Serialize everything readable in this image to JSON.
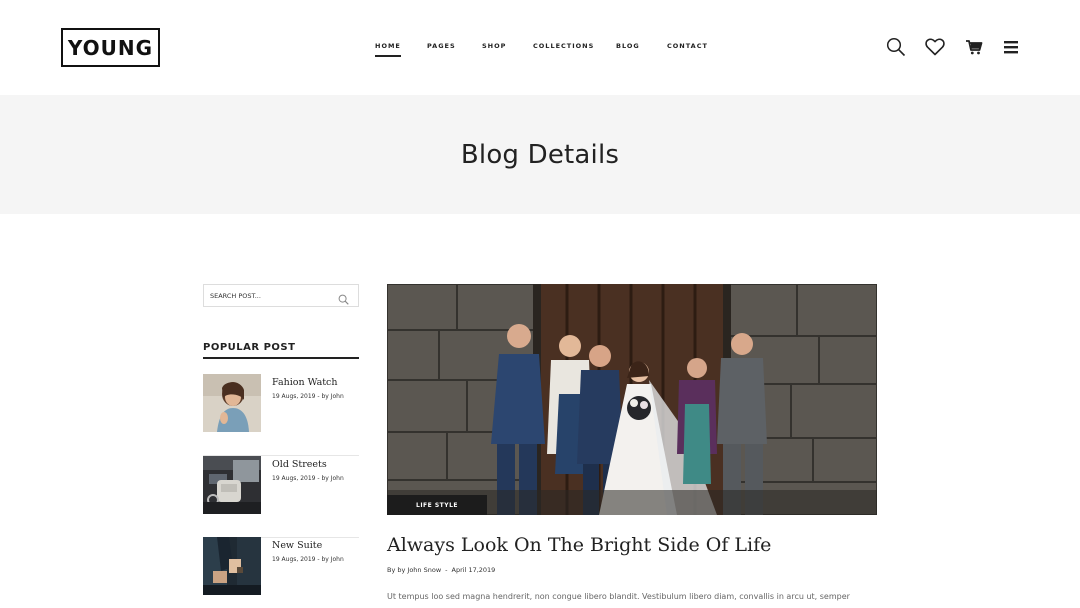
{
  "header": {
    "logo": "YOUNG",
    "nav": [
      {
        "label": "HOME",
        "active": true
      },
      {
        "label": "PAGES",
        "active": false
      },
      {
        "label": "SHOP",
        "active": false
      },
      {
        "label": "COLLECTIONS",
        "active": false
      },
      {
        "label": "BLOG",
        "active": false
      },
      {
        "label": "CONTACT",
        "active": false
      }
    ],
    "icons": [
      "search-icon",
      "heart-icon",
      "cart-icon",
      "menu-icon"
    ]
  },
  "banner": {
    "title": "Blog Details"
  },
  "sidebar": {
    "search_placeholder": "SEARCH POST...",
    "popular_title": "POPULAR POST",
    "posts": [
      {
        "title": "Fahion Watch",
        "meta": "19 Augs, 2019 - by John"
      },
      {
        "title": "Old Streets",
        "meta": "19 Augs, 2019 - by John"
      },
      {
        "title": "New Suite",
        "meta": "19 Augs, 2019 - by John"
      }
    ]
  },
  "article": {
    "tag": "LIFE STYLE",
    "title": "Always Look On The Bright Side Of Life",
    "author": "By by John Snow",
    "separator": "-",
    "date": "April 17,2019",
    "excerpt": "Ut tempus loo sed magna hendrerit, non congue libero blandit. Vestibulum libero diam, convallis in arcu ut, semper"
  },
  "colors": {
    "text": "#222222",
    "banner_bg": "#f5f5f5",
    "tag_bg": "#1c1c1c"
  }
}
